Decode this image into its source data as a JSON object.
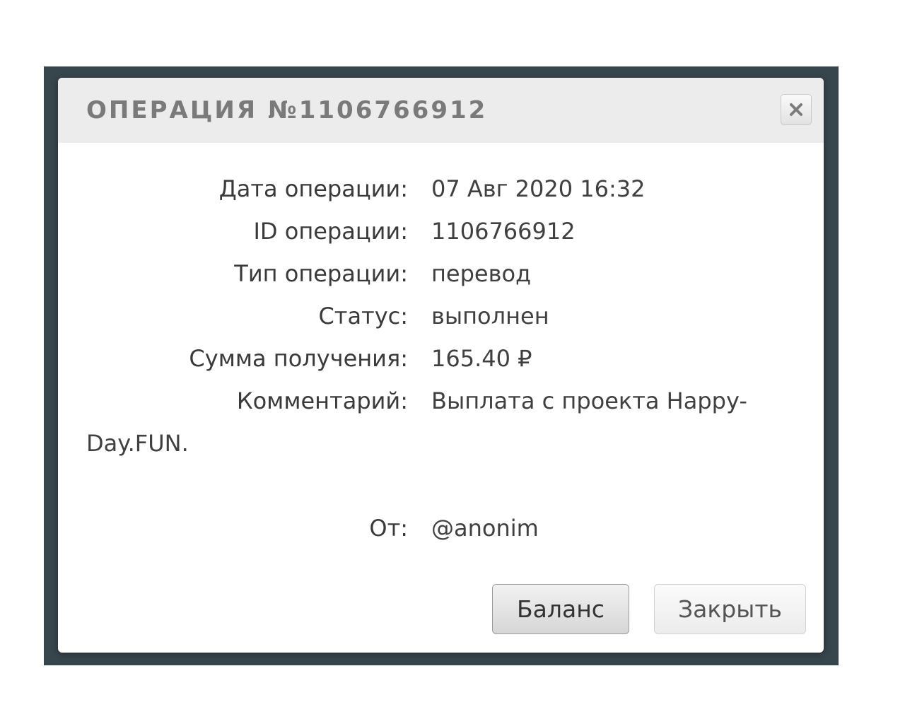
{
  "dialog": {
    "title": "ОПЕРАЦИЯ №1106766912",
    "close_icon": "close-icon",
    "fields": {
      "date": {
        "label": "Дата операции:",
        "value": "07 Авг 2020 16:32"
      },
      "id": {
        "label": "ID операции:",
        "value": "1106766912"
      },
      "type": {
        "label": "Тип операции:",
        "value": "перевод"
      },
      "status": {
        "label": "Статус:",
        "value": "выполнен"
      },
      "amount": {
        "label": "Сумма получения:",
        "value": "165.40 ₽"
      },
      "comment": {
        "label": "Комментарий:",
        "value_line1": "Выплата с проекта Happy-",
        "value_line2": "Day.FUN."
      },
      "from": {
        "label": "От:",
        "value": "@anonim"
      }
    },
    "buttons": {
      "balance": "Баланс",
      "close": "Закрыть"
    }
  },
  "colors": {
    "backdrop": "#37454d",
    "header": "#ececec",
    "title": "#7a7a7a"
  }
}
